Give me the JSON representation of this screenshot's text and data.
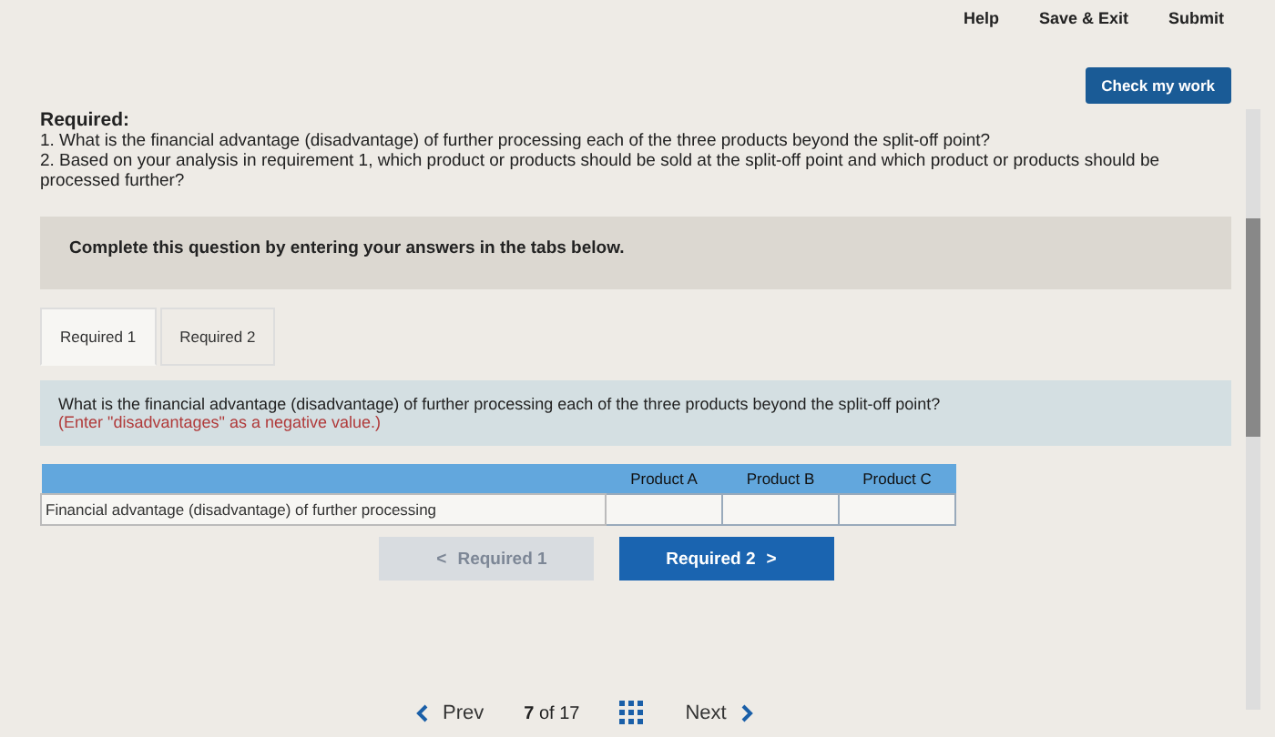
{
  "top_links": [
    "Help",
    "Save & Exit",
    "Submit"
  ],
  "check_button": "Check my work",
  "required": {
    "heading": "Required:",
    "items": [
      "1. What is the financial advantage (disadvantage) of further processing each of the three products beyond the split-off point?",
      "2. Based on your analysis in requirement 1, which product or products should be sold at the split-off point and which product or products should be processed further?"
    ]
  },
  "instruction": "Complete this question by entering your answers in the tabs below.",
  "tabs": [
    {
      "label": "Required 1",
      "selected": true
    },
    {
      "label": "Required 2",
      "selected": false
    }
  ],
  "question": {
    "text": "What is the financial advantage (disadvantage) of further processing each of the three products beyond the split-off point?",
    "note": "(Enter \"disadvantages\" as a negative value.)"
  },
  "table": {
    "columns": [
      "Product A",
      "Product B",
      "Product C"
    ],
    "rows": [
      {
        "label": "Financial advantage (disadvantage) of further processing"
      }
    ]
  },
  "nav_buttons": [
    {
      "label": "Required 1",
      "arrow": "<",
      "disabled": true
    },
    {
      "label": "Required 2",
      "arrow": ">",
      "disabled": false
    }
  ],
  "pager": {
    "prev": "Prev",
    "current": "7",
    "of": "of 17",
    "next": "Next"
  }
}
